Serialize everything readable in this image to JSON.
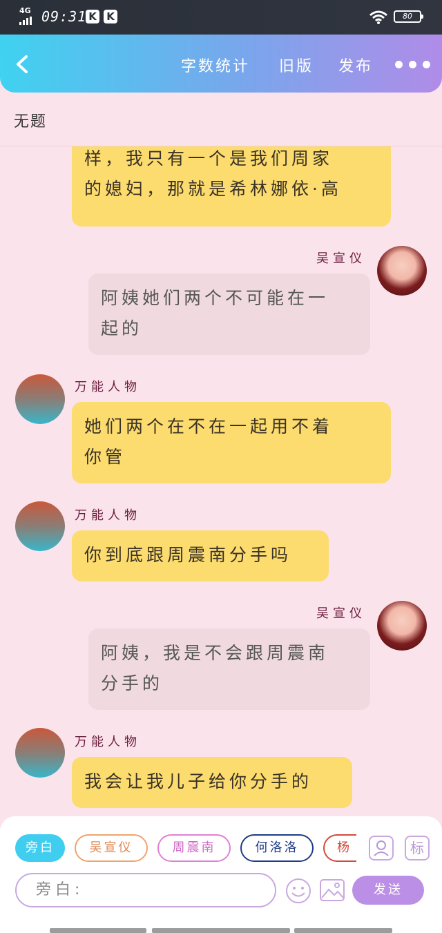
{
  "status_bar": {
    "network": "4G",
    "time": "09:31",
    "app_badges": [
      "K",
      "K"
    ],
    "battery": "80"
  },
  "header": {
    "word_count": "字数统计",
    "old_version": "旧版",
    "publish": "发布"
  },
  "doc_title": "无题",
  "messages": [
    {
      "side": "left",
      "text": "的媳妇，那就是希林娜依·高"
    },
    {
      "side": "right",
      "name": "吴宣仪",
      "text_line1": "阿姨她们两个不可能在一",
      "text_line2": "起的"
    },
    {
      "side": "left",
      "name": "万能人物",
      "text_line1": "她们两个在不在一起用不着",
      "text_line2": "你管"
    },
    {
      "side": "left",
      "name": "万能人物",
      "text": "你到底跟周震南分手吗"
    },
    {
      "side": "right",
      "name": "吴宣仪",
      "text_line1": "阿姨，我是不会跟周震南",
      "text_line2": "分手的"
    },
    {
      "side": "left",
      "name": "万能人物",
      "text": "我会让我儿子给你分手的"
    }
  ],
  "partial_first_bubble": {
    "line1": "样，我只有一个是我们周家"
  },
  "characters": [
    "旁白",
    "吴宣仪",
    "周震南",
    "何洛洛",
    "杨"
  ],
  "side_icons": {
    "person": "person-card-icon",
    "tag": "标"
  },
  "input": {
    "placeholder": "旁白:"
  },
  "send_label": "发送",
  "colors": {
    "header_gradient_start": "#3fd2f0",
    "header_gradient_end": "#b08ce8",
    "bubble_left": "#fcdc6e",
    "bubble_right": "#f0dadf",
    "background": "#fbe3ec",
    "send": "#bb8fe6"
  }
}
